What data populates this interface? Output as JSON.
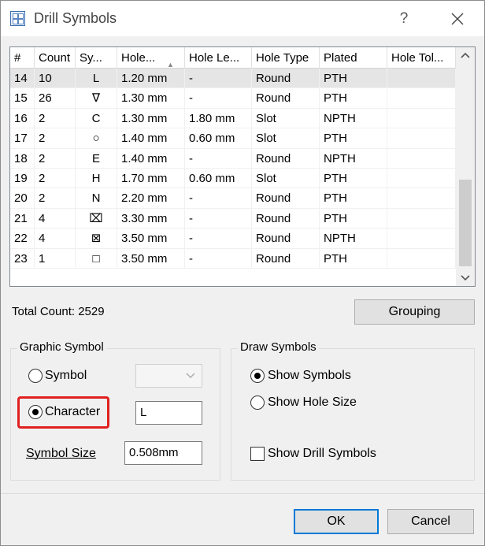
{
  "window": {
    "title": "Drill Symbols",
    "help_label": "?",
    "icons": {
      "app": "table-grid-icon",
      "close": "close-icon"
    }
  },
  "table": {
    "columns": [
      "#",
      "Count",
      "Sy...",
      "Hole...",
      "Hole Le...",
      "Hole Type",
      "Plated",
      "Hole Tol..."
    ],
    "sorted_column": "Hole...",
    "sort_indicator": "▲",
    "rows": [
      {
        "num": "14",
        "count": "10",
        "symbol": "L",
        "hole_size": "1.20 mm",
        "hole_length": "-",
        "hole_type": "Round",
        "plated": "PTH",
        "tolerance": ""
      },
      {
        "num": "15",
        "count": "26",
        "symbol": "∇",
        "hole_size": "1.30 mm",
        "hole_length": "-",
        "hole_type": "Round",
        "plated": "PTH",
        "tolerance": ""
      },
      {
        "num": "16",
        "count": "2",
        "symbol": "C",
        "hole_size": "1.30 mm",
        "hole_length": "1.80 mm",
        "hole_type": "Slot",
        "plated": "NPTH",
        "tolerance": ""
      },
      {
        "num": "17",
        "count": "2",
        "symbol": "○",
        "hole_size": "1.40 mm",
        "hole_length": "0.60 mm",
        "hole_type": "Slot",
        "plated": "PTH",
        "tolerance": ""
      },
      {
        "num": "18",
        "count": "2",
        "symbol": "E",
        "hole_size": "1.40 mm",
        "hole_length": "-",
        "hole_type": "Round",
        "plated": "NPTH",
        "tolerance": ""
      },
      {
        "num": "19",
        "count": "2",
        "symbol": "H",
        "hole_size": "1.70 mm",
        "hole_length": "0.60 mm",
        "hole_type": "Slot",
        "plated": "PTH",
        "tolerance": ""
      },
      {
        "num": "20",
        "count": "2",
        "symbol": "N",
        "hole_size": "2.20 mm",
        "hole_length": "-",
        "hole_type": "Round",
        "plated": "PTH",
        "tolerance": ""
      },
      {
        "num": "21",
        "count": "4",
        "symbol": "⌧",
        "hole_size": "3.30 mm",
        "hole_length": "-",
        "hole_type": "Round",
        "plated": "PTH",
        "tolerance": ""
      },
      {
        "num": "22",
        "count": "4",
        "symbol": "⊠",
        "hole_size": "3.50 mm",
        "hole_length": "-",
        "hole_type": "Round",
        "plated": "NPTH",
        "tolerance": ""
      },
      {
        "num": "23",
        "count": "1",
        "symbol": "□",
        "hole_size": "3.50 mm",
        "hole_length": "-",
        "hole_type": "Round",
        "plated": "PTH",
        "tolerance": ""
      }
    ],
    "selected_row": "14"
  },
  "summary": {
    "total_count_label": "Total Count: 2529",
    "grouping_button": "Grouping"
  },
  "graphic_symbol": {
    "title": "Graphic Symbol",
    "symbol_option": "Symbol",
    "character_option": "Character",
    "selected": "Character",
    "character_value": "L",
    "symbol_size_label": "Symbol Size",
    "symbol_size_value": "0.508mm"
  },
  "draw_symbols": {
    "title": "Draw Symbols",
    "show_symbols": "Show Symbols",
    "show_hole_size": "Show Hole Size",
    "selected": "Show Symbols",
    "show_drill_symbols": "Show Drill Symbols",
    "show_drill_symbols_checked": false
  },
  "footer": {
    "ok": "OK",
    "cancel": "Cancel"
  },
  "colors": {
    "highlight_border": "#e02020",
    "primary_border": "#0078d7",
    "selected_row": "#e5e5e5"
  }
}
